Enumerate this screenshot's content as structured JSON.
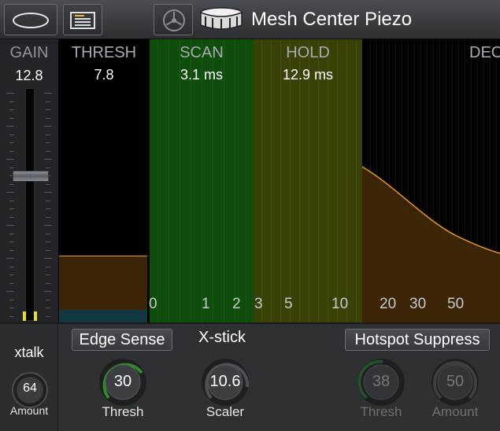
{
  "header": {
    "title": "Mesh Center Piezo",
    "buttons": [
      {
        "name": "oval-button",
        "icon": "oval-icon"
      },
      {
        "name": "menu-button",
        "icon": "list-icon"
      },
      {
        "name": "logo-button",
        "icon": "tuning-fork-logo-icon"
      }
    ],
    "drum_icon": "snare-drum-icon"
  },
  "gain": {
    "label": "GAIN",
    "value": "12.8",
    "level": 0.62
  },
  "graph": {
    "sections": [
      {
        "key": "thresh",
        "title": "THRESH",
        "value": "7.8"
      },
      {
        "key": "scan",
        "title": "SCAN",
        "value": "3.1 ms"
      },
      {
        "key": "hold",
        "title": "HOLD",
        "value": "12.9 ms"
      },
      {
        "key": "decay",
        "title": "DEC",
        "value": ""
      }
    ],
    "x_ticks": [
      "0",
      "1",
      "2",
      "3",
      "5",
      "10",
      "20",
      "30",
      "50"
    ],
    "colors": {
      "scan": "#0e4d0b",
      "hold": "#3a4106",
      "curve": "#e09a2a"
    }
  },
  "xtalk": {
    "label": "xtalk",
    "knob_value": "64",
    "knob_label": "Amount"
  },
  "edge_sense": {
    "label": "Edge Sense",
    "knob_value": "30",
    "knob_label": "Thresh"
  },
  "xstick": {
    "label": "X-stick",
    "knob_value": "10.6",
    "knob_label": "Scaler"
  },
  "hotspot": {
    "label": "Hotspot Suppress",
    "knobs": [
      {
        "value": "38",
        "label": "Thresh"
      },
      {
        "value": "50",
        "label": "Amount"
      }
    ]
  }
}
